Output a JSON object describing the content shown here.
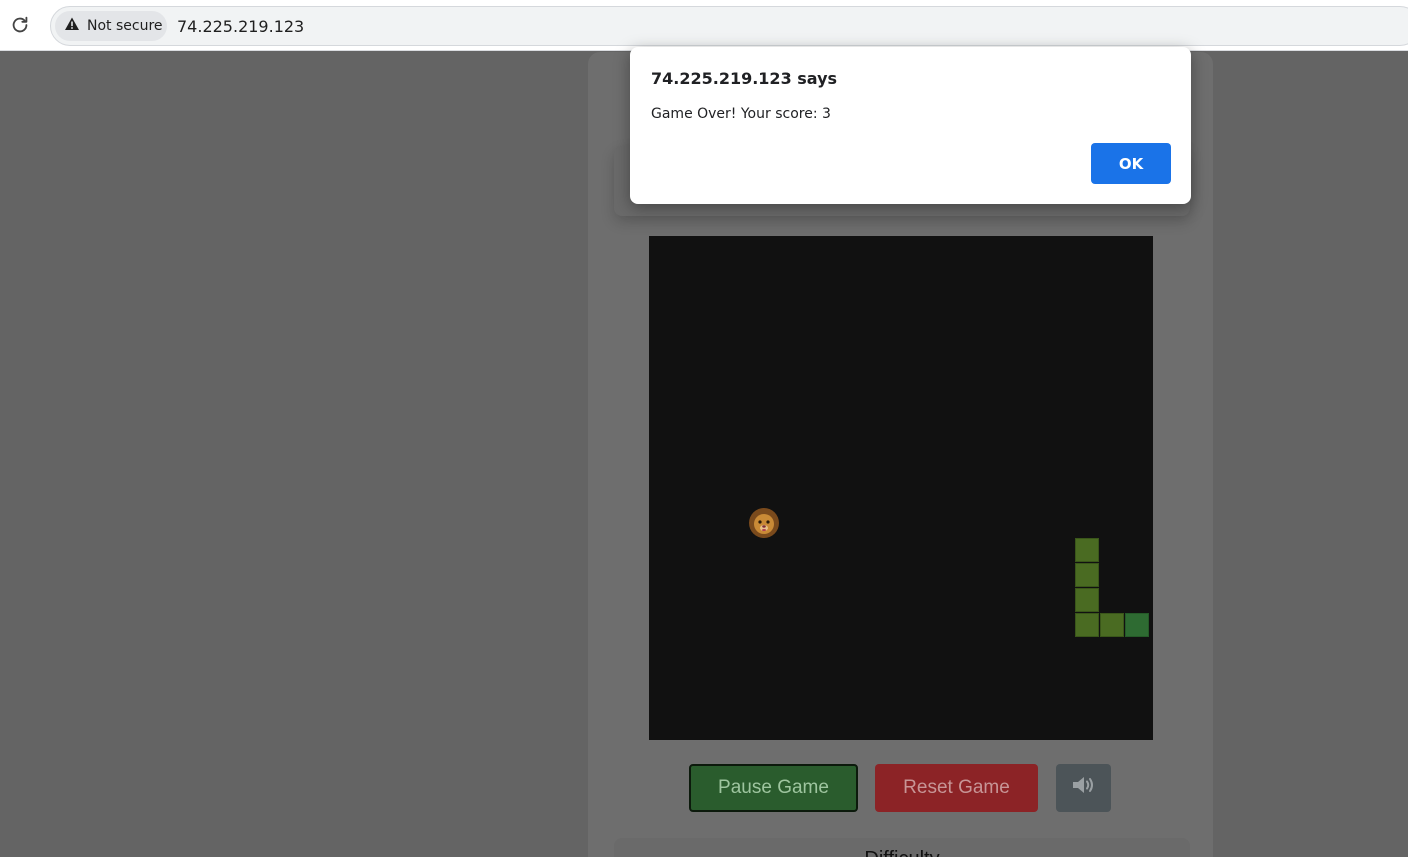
{
  "browser": {
    "security_label": "Not secure",
    "url": "74.225.219.123"
  },
  "dialog": {
    "title": "74.225.219.123 says",
    "message": "Game Over! Your score: 3",
    "ok_label": "OK"
  },
  "game": {
    "food_icon": "lion-face-icon",
    "snake_color": "#4a6b22",
    "snake_head_color": "#2e6b32",
    "board_color": "#111111"
  },
  "controls": {
    "pause_label": "Pause Game",
    "reset_label": "Reset Game",
    "sound_icon": "speaker-icon"
  },
  "difficulty": {
    "label": "Difficulty"
  }
}
